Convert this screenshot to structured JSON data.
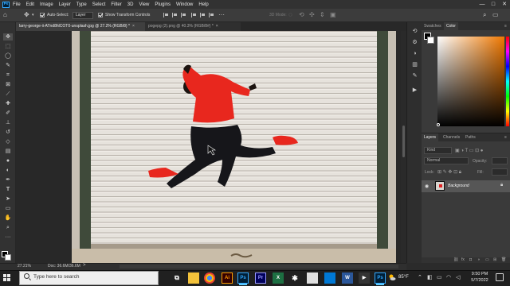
{
  "app": {
    "logo": "Ps",
    "menu": [
      "File",
      "Edit",
      "Image",
      "Layer",
      "Type",
      "Select",
      "Filter",
      "3D",
      "View",
      "Plugins",
      "Window",
      "Help"
    ],
    "window_controls": [
      "—",
      "□",
      "✕"
    ]
  },
  "options_bar": {
    "auto_select_label": "Auto-Select:",
    "auto_select_value": "Layer",
    "transform_label": "Show Transform Controls",
    "mode_3d_label": "3D Mode:"
  },
  "tabs": [
    {
      "label": "larry-george-ii-ATnd8hlCOT0-unsplash.jpg @ 27.2% (RGB/8) *",
      "close": "×",
      "active": true
    },
    {
      "label": "pogepg (2).png @ 40.3% (RGB/8#) *",
      "close": "×",
      "active": false
    }
  ],
  "tools": [
    "move-tool",
    "artboard-tool",
    "marquee-tool",
    "lasso-tool",
    "quick-select-tool",
    "crop-tool",
    "frame-tool",
    "eyedropper-tool",
    "healing-brush-tool",
    "brush-tool",
    "clone-stamp-tool",
    "history-brush-tool",
    "eraser-tool",
    "gradient-tool",
    "blur-tool",
    "dodge-tool",
    "pen-tool",
    "type-tool",
    "path-select-tool",
    "rectangle-tool",
    "hand-tool",
    "zoom-tool",
    "more-tools"
  ],
  "color_panel": {
    "tabs": [
      "Swatches",
      "Color"
    ],
    "active_tab": "Color",
    "foreground": "#000000",
    "background": "#ffffff",
    "hue": "#f07800"
  },
  "layers_panel": {
    "tabs": [
      "Layers",
      "Channels",
      "Paths"
    ],
    "kind_placeholder": "Kind",
    "blend_mode": "Normal",
    "opacity_label": "Opacity:",
    "lock_label": "Lock:",
    "fill_label": "Fill:",
    "layers": [
      {
        "name": "Background",
        "visible": true,
        "locked": true
      }
    ]
  },
  "status": {
    "zoom": "27.21%",
    "doc": "Doc: 36.6M/36.6M",
    "chevron": ">"
  },
  "taskbar": {
    "search_placeholder": "Type here to search",
    "temperature": "85°F",
    "time": "9:50 PM",
    "date": "5/7/2022",
    "apps": [
      "task-view",
      "folder",
      "chrome",
      "illustrator",
      "photoshop",
      "premiere",
      "excel",
      "bluetooth",
      "files",
      "photos",
      "word",
      "media",
      "file-explorer",
      "after-effects",
      "photoshop-2"
    ]
  }
}
